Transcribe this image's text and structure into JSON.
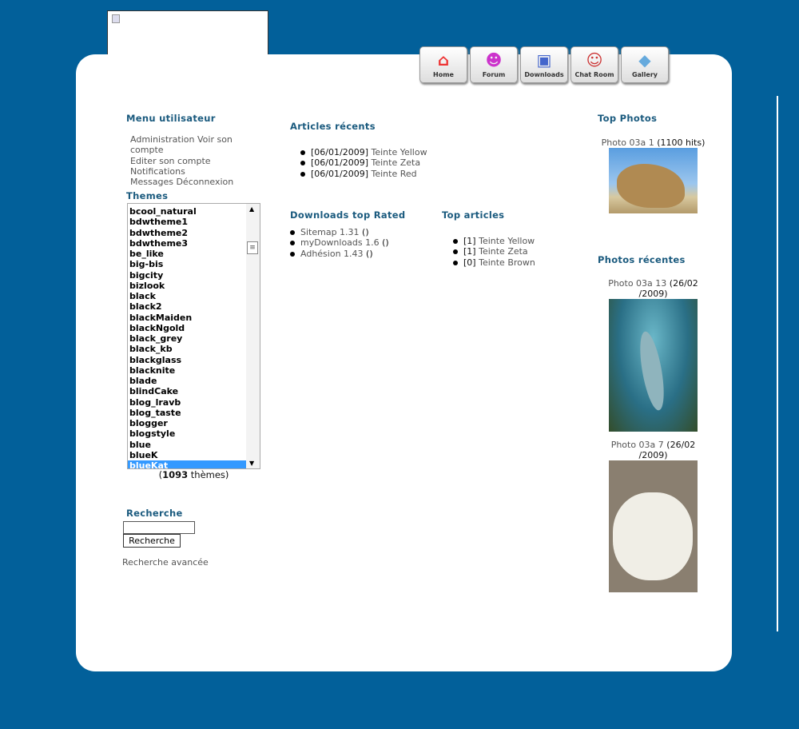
{
  "nav": [
    {
      "label": "Home",
      "icon": "house-icon"
    },
    {
      "label": "Forum",
      "icon": "users-icon"
    },
    {
      "label": "Downloads",
      "icon": "floppy-icon"
    },
    {
      "label": "Chat Room",
      "icon": "chat-icon"
    },
    {
      "label": "Gallery",
      "icon": "gallery-icon"
    }
  ],
  "user_menu": {
    "title": "Menu utilisateur",
    "links": [
      "Administration",
      "Voir son compte",
      "Editer son compte",
      "Notifications",
      "Messages",
      "Déconnexion"
    ]
  },
  "themes": {
    "title": "Themes",
    "items": [
      "bcool_natural",
      "bdwtheme1",
      "bdwtheme2",
      "bdwtheme3",
      "be_like",
      "big-bis",
      "bigcity",
      "bizlook",
      "black",
      "black2",
      "blackMaiden",
      "blackNgold",
      "black_grey",
      "black_kb",
      "blackglass",
      "blacknite",
      "blade",
      "blindCake",
      "blog_lravb",
      "blog_taste",
      "blogger",
      "blogstyle",
      "blue",
      "blueK",
      "blueKat"
    ],
    "selected": "blueKat",
    "count": "1093",
    "count_suffix": " thèmes)",
    "count_prefix": "("
  },
  "search": {
    "title": "Recherche",
    "value": "",
    "button": "Recherche",
    "advanced": "Recherche avancée"
  },
  "articles": {
    "title": "Articles récents",
    "items": [
      {
        "date": "[06/01/2009]",
        "title": "Teinte Yellow"
      },
      {
        "date": "[06/01/2009]",
        "title": "Teinte Zeta"
      },
      {
        "date": "[06/01/2009]",
        "title": "Teinte Red"
      }
    ]
  },
  "downloads": {
    "title": "Downloads top Rated",
    "items": [
      {
        "name": "Sitemap 1.31",
        "extra": "()"
      },
      {
        "name": "myDownloads 1.6",
        "extra": "()"
      },
      {
        "name": "Adhésion 1.43",
        "extra": "()"
      }
    ]
  },
  "top_articles": {
    "title": "Top articles",
    "items": [
      {
        "count": "[1]",
        "title": "Teinte Yellow"
      },
      {
        "count": "[1]",
        "title": "Teinte Zeta"
      },
      {
        "count": "[0]",
        "title": "Teinte Brown"
      }
    ]
  },
  "top_photos": {
    "title": "Top Photos",
    "items": [
      {
        "name": "Photo 03a 1",
        "meta": "(1100 hits)"
      }
    ]
  },
  "recent_photos": {
    "title": "Photos récentes",
    "items": [
      {
        "name": "Photo 03a 13",
        "meta": "(26/02 /2009)"
      },
      {
        "name": "Photo 03a 7",
        "meta": "(26/02 /2009)"
      }
    ]
  }
}
